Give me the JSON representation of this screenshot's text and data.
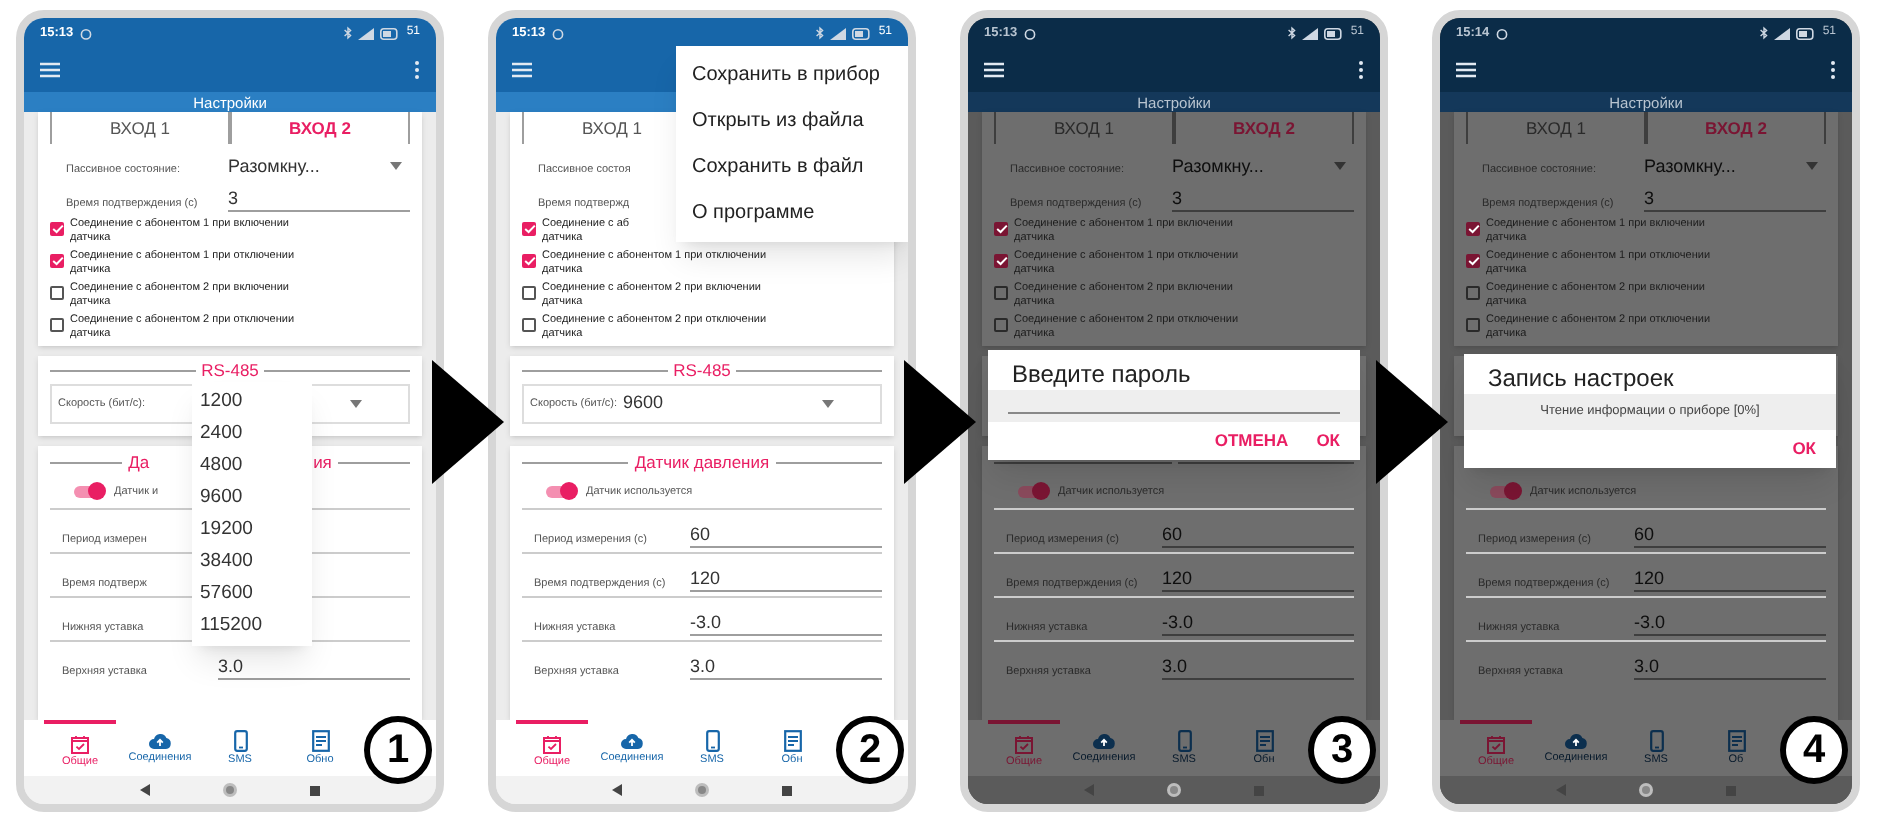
{
  "phones": [
    {
      "step": "1",
      "dimmed": false,
      "status": {
        "time": "15:13",
        "battery": "51"
      },
      "title": "Настройки",
      "tabs": [
        {
          "label": "ВХОД 1",
          "selected": false
        },
        {
          "label": "ВХОД 2",
          "selected": true
        }
      ],
      "fields": [
        {
          "kind": "select",
          "label": "Пассивное состояние:",
          "value": "Разомкну..."
        },
        {
          "kind": "text",
          "label": "Время подтверждения (с)",
          "value": "3"
        }
      ],
      "checkboxes": [
        {
          "lines": [
            "Соединение с абонентом 1 при включении",
            "датчика"
          ],
          "checked": true
        },
        {
          "lines": [
            "Соединение с абонентом 1 при отключении",
            "датчика"
          ],
          "checked": true
        },
        {
          "lines": [
            "Соединение с абонентом 2 при включении",
            "датчика"
          ],
          "checked": false
        },
        {
          "lines": [
            "Соединение с абонентом 2 при отключении",
            "датчика"
          ],
          "checked": false
        }
      ],
      "rs485": {
        "title": "RS-485",
        "label": "Скорость (бит/с):"
      },
      "pressure": {
        "title_parts": [
          "Да",
          "ия"
        ],
        "switch": {
          "label": "Датчик и",
          "on": true
        },
        "rows": [
          {
            "label": "Период измерен"
          },
          {
            "label": "Время подтверж"
          },
          {
            "label": "Нижняя уставка"
          },
          {
            "label": "Верхняя уставка",
            "value": "3.0"
          }
        ]
      },
      "nav": [
        {
          "kind": "calendar",
          "label": "Общие",
          "selected": true
        },
        {
          "kind": "cloud",
          "label": "Соединения",
          "selected": false
        },
        {
          "kind": "phone",
          "label": "SMS",
          "selected": false
        },
        {
          "kind": "document",
          "label": "Обно",
          "selected": false
        }
      ],
      "overlay": {
        "kind": "dropdown",
        "options": [
          "1200",
          "2400",
          "4800",
          "9600",
          "19200",
          "38400",
          "57600",
          "115200"
        ]
      }
    },
    {
      "step": "2",
      "dimmed": false,
      "status": {
        "time": "15:13",
        "battery": "51"
      },
      "tabs": [
        {
          "label": "ВХОД 1",
          "selected": false
        }
      ],
      "fields": [
        {
          "label": "Пассивное состоя"
        },
        {
          "label": "Время подтвержд"
        }
      ],
      "checkboxes": [
        {
          "lines": [
            "Соединение с аб",
            "датчика"
          ],
          "checked": true
        },
        {
          "lines": [
            "Соединение с абонентом 1 при отключении",
            "датчика"
          ],
          "checked": true
        },
        {
          "lines": [
            "Соединение с абонентом 2 при включении",
            "датчика"
          ],
          "checked": false
        },
        {
          "lines": [
            "Соединение с абонентом 2 при отключении",
            "датчика"
          ],
          "checked": false
        }
      ],
      "rs485": {
        "title": "RS-485",
        "label": "Скорость (бит/с):",
        "value": "9600"
      },
      "pressure": {
        "title_parts": [
          "Датчик давления"
        ],
        "switch": {
          "label": "Датчик используется",
          "on": true
        },
        "rows": [
          {
            "label": "Период измерения (с)",
            "value": "60"
          },
          {
            "label": "Время подтверждения (с)",
            "value": "120"
          },
          {
            "label": "Нижняя уставка",
            "value": "-3.0"
          },
          {
            "label": "Верхняя уставка",
            "value": "3.0"
          }
        ]
      },
      "nav": [
        {
          "kind": "calendar",
          "label": "Общие",
          "selected": true
        },
        {
          "kind": "cloud",
          "label": "Соединения",
          "selected": false
        },
        {
          "kind": "phone",
          "label": "SMS",
          "selected": false
        },
        {
          "kind": "document",
          "label": "Обн",
          "selected": false
        }
      ],
      "overlay": {
        "kind": "menu",
        "items": [
          "Сохранить в прибор",
          "Открыть из файла",
          "Сохранить в файл",
          "О программе"
        ]
      }
    },
    {
      "step": "3",
      "dimmed": true,
      "status": {
        "time": "15:13",
        "battery": "51"
      },
      "title": "Настройки",
      "tabs": [
        {
          "label": "ВХОД 1",
          "selected": false
        },
        {
          "label": "ВХОД 2",
          "selected": true
        }
      ],
      "fields": [
        {
          "kind": "select",
          "label": "Пассивное состояние:",
          "value": "Разомкну..."
        },
        {
          "kind": "text",
          "label": "Время подтверждения (с)",
          "value": "3"
        }
      ],
      "checkboxes": [
        {
          "lines": [
            "Соединение с абонентом 1 при включении",
            "датчика"
          ],
          "checked": true
        },
        {
          "lines": [
            "Соединение с абонентом 1 при отключении",
            "датчика"
          ],
          "checked": true
        },
        {
          "lines": [
            "Соединение с абонентом 2 при включении",
            "датчика"
          ],
          "checked": false
        },
        {
          "lines": [
            "Соединение с абонентом 2 при отключении",
            "датчика"
          ],
          "checked": false
        }
      ],
      "pressure": {
        "switch": {
          "label": "Датчик используется",
          "on": true
        },
        "rows": [
          {
            "label": "Период измерения (с)",
            "value": "60"
          },
          {
            "label": "Время подтверждения (с)",
            "value": "120"
          },
          {
            "label": "Нижняя уставка",
            "value": "-3.0"
          },
          {
            "label": "Верхняя уставка",
            "value": "3.0"
          }
        ]
      },
      "nav": [
        {
          "kind": "calendar",
          "label": "Общие",
          "selected": true
        },
        {
          "kind": "cloud",
          "label": "Соединения",
          "selected": false
        },
        {
          "kind": "phone",
          "label": "SMS",
          "selected": false
        },
        {
          "kind": "document",
          "label": "Обн",
          "selected": false
        }
      ],
      "overlay": {
        "kind": "password_dialog",
        "title": "Введите пароль",
        "buttons": [
          "ОТМЕНА",
          "ОК"
        ]
      }
    },
    {
      "step": "4",
      "dimmed": true,
      "status": {
        "time": "15:14",
        "battery": "51"
      },
      "title": "Настройки",
      "tabs": [
        {
          "label": "ВХОД 1",
          "selected": false
        },
        {
          "label": "ВХОД 2",
          "selected": true
        }
      ],
      "fields": [
        {
          "kind": "select",
          "label": "Пассивное состояние:",
          "value": "Разомкну..."
        },
        {
          "kind": "text",
          "label": "Время подтверждения (с)",
          "value": "3"
        }
      ],
      "checkboxes": [
        {
          "lines": [
            "Соединение с абонентом 1 при включении",
            "датчика"
          ],
          "checked": true
        },
        {
          "lines": [
            "Соединение с абонентом 1 при отключении",
            "датчика"
          ],
          "checked": true
        },
        {
          "lines": [
            "Соединение с абонентом 2 при включении",
            "датчика"
          ],
          "checked": false
        },
        {
          "lines": [
            "Соединение с абонентом 2 при отключении",
            "датчика"
          ],
          "checked": false
        }
      ],
      "pressure": {
        "switch": {
          "label": "Датчик используется",
          "on": true
        },
        "rows": [
          {
            "label": "Период измерения (с)",
            "value": "60"
          },
          {
            "label": "Время подтверждения (с)",
            "value": "120"
          },
          {
            "label": "Нижняя уставка",
            "value": "-3.0"
          },
          {
            "label": "Верхняя уставка",
            "value": "3.0"
          }
        ]
      },
      "nav": [
        {
          "kind": "calendar",
          "label": "Общие",
          "selected": true
        },
        {
          "kind": "cloud",
          "label": "Соединения",
          "selected": false
        },
        {
          "kind": "phone",
          "label": "SMS",
          "selected": false
        },
        {
          "kind": "document",
          "label": "Об",
          "selected": false
        }
      ],
      "overlay": {
        "kind": "progress_dialog",
        "title": "Запись настроек",
        "message": "Чтение информации о приборе [0%]",
        "buttons": [
          "ОК"
        ]
      }
    }
  ]
}
